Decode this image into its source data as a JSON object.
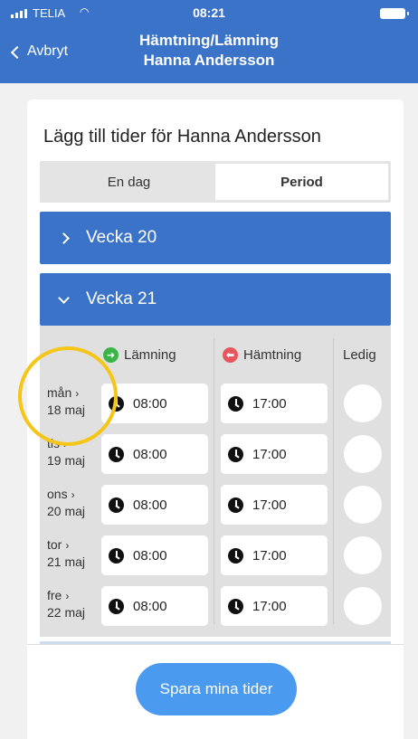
{
  "status_bar": {
    "carrier": "TELIA",
    "time": "08:21"
  },
  "nav": {
    "back_label": "Avbryt",
    "title_line1": "Hämtning/Lämning",
    "title_line2": "Hanna Andersson"
  },
  "card": {
    "title": "Lägg till tider för Hanna Andersson"
  },
  "segment": {
    "options": [
      "En dag",
      "Period"
    ],
    "selected": "Period"
  },
  "weeks": [
    {
      "label": "Vecka 20",
      "expanded": false
    },
    {
      "label": "Vecka 21",
      "expanded": true
    }
  ],
  "columns": {
    "drop_off": "Lämning",
    "pick_up": "Hämtning",
    "free": "Ledig"
  },
  "days": [
    {
      "weekday": "mån",
      "date": "18 maj",
      "drop_off": "08:00",
      "pick_up": "17:00"
    },
    {
      "weekday": "tis",
      "date": "19 maj",
      "drop_off": "08:00",
      "pick_up": "17:00"
    },
    {
      "weekday": "ons",
      "date": "20 maj",
      "drop_off": "08:00",
      "pick_up": "17:00"
    },
    {
      "weekday": "tor",
      "date": "21 maj",
      "drop_off": "08:00",
      "pick_up": "17:00"
    },
    {
      "weekday": "fre",
      "date": "22 maj",
      "drop_off": "08:00",
      "pick_up": "17:00"
    }
  ],
  "save_button": "Spara mina tider",
  "colors": {
    "primary": "#3a73c8",
    "save": "#4a9af0",
    "green": "#3bb54a",
    "red": "#e8565d",
    "highlight": "#f5c518"
  }
}
